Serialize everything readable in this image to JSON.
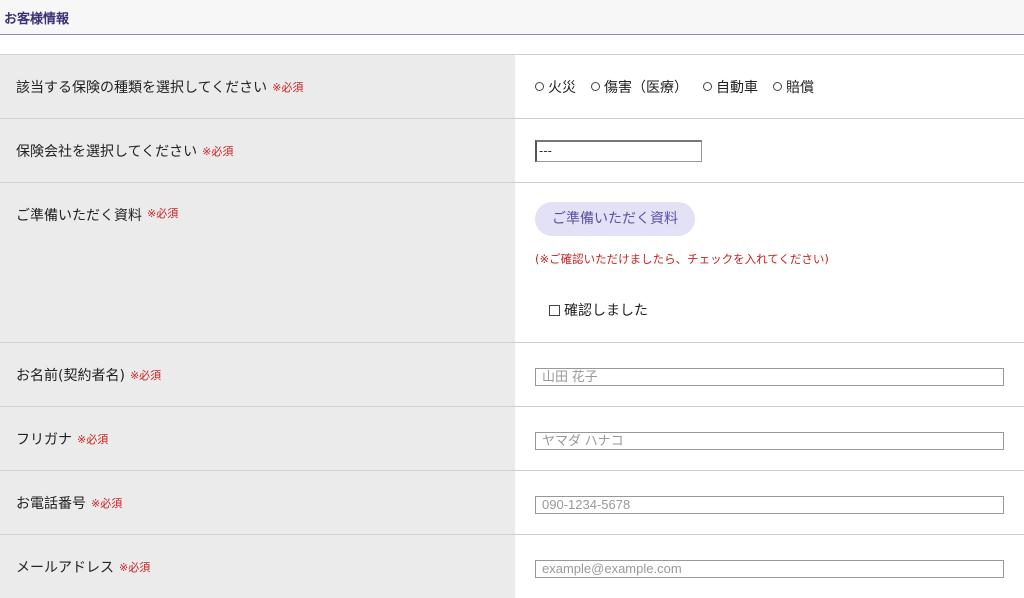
{
  "section": {
    "title": "お客様情報"
  },
  "required_mark": "※必須",
  "fields": {
    "insurance_type": {
      "label": "該当する保険の種類を選択してください",
      "options": [
        "火災",
        "傷害（医療）",
        "自動車",
        "賠償"
      ]
    },
    "company": {
      "label": "保険会社を選択してください",
      "selected": "---"
    },
    "documents": {
      "label": "ご準備いただく資料",
      "button_label": "ご準備いただく資料",
      "note": "(※ご確認いただけましたら、チェックを入れてください)",
      "checkbox_label": "確認しました"
    },
    "name": {
      "label": "お名前(契約者名)",
      "placeholder": "山田 花子"
    },
    "kana": {
      "label": "フリガナ",
      "placeholder": "ヤマダ ハナコ"
    },
    "phone": {
      "label": "お電話番号",
      "placeholder": "090-1234-5678"
    },
    "email": {
      "label": "メールアドレス",
      "placeholder": "example@example.com"
    }
  }
}
